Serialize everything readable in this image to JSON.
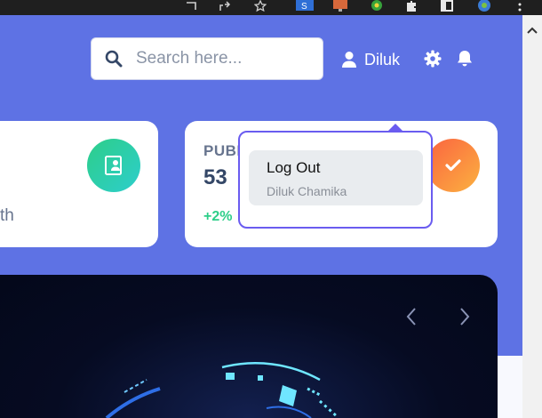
{
  "header": {
    "search_placeholder": "Search here...",
    "user_name": "Diluk"
  },
  "cards": {
    "left_partial_text": "th",
    "right_label": "PUBL",
    "right_value": "53",
    "right_change": "+2%"
  },
  "dropdown": {
    "items": [
      {
        "title": "Log Out",
        "subtitle": "Diluk Chamika"
      }
    ]
  },
  "colors": {
    "primary": "#5e72e4",
    "dropdown_border": "#6a5cf0",
    "success": "#2dce89",
    "warning": "#fb6340"
  }
}
